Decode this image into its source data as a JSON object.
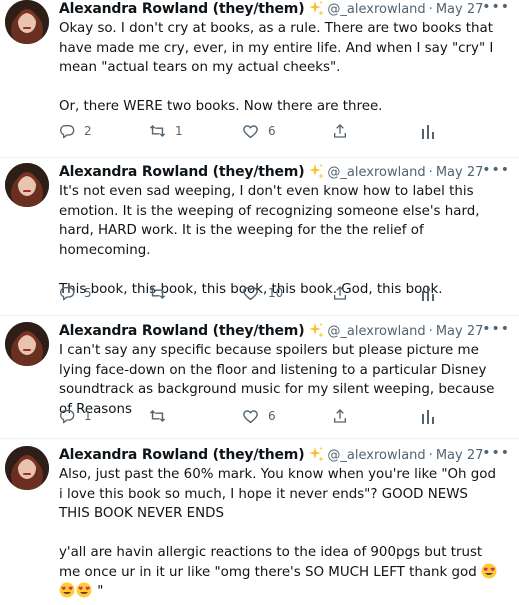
{
  "tweets": [
    {
      "author": "Alexandra Rowland (they/them)",
      "handle": "@_alexrowland",
      "separator": "·",
      "date": "May 27",
      "paragraphs": [
        "Okay so. I don't cry at books, as a rule. There are two books that have made me cry, ever, in my entire life. And when I say \"cry\" I mean \"actual tears on my actual cheeks\".",
        "Or, there WERE two books. Now there are three."
      ],
      "replies": "2",
      "retweets": "1",
      "likes": "6"
    },
    {
      "author": "Alexandra Rowland (they/them)",
      "handle": "@_alexrowland",
      "separator": "·",
      "date": "May 27",
      "paragraphs": [
        "It's not even sad weeping, I don't even know how to label this emotion. It is the weeping of recognizing someone else's hard, hard, HARD work. It is the weeping for the the relief of homecoming.",
        "This book, this book, this book, this book. God, this book."
      ],
      "replies": "5",
      "retweets": "",
      "likes": "10"
    },
    {
      "author": "Alexandra Rowland (they/them)",
      "handle": "@_alexrowland",
      "separator": "·",
      "date": "May 27",
      "paragraphs": [
        "I can't say any specific because spoilers but please picture me lying face-down on the floor and listening to a particular Disney soundtrack as background music for my silent weeping, because of Reasons"
      ],
      "replies": "1",
      "retweets": "",
      "likes": "6"
    },
    {
      "author": "Alexandra Rowland (they/them)",
      "handle": "@_alexrowland",
      "separator": "·",
      "date": "May 27",
      "paragraphs": [
        "Also, just past the 60% mark. You know when you're like \"Oh god i love this book so much, I hope it never ends\"? GOOD NEWS THIS BOOK NEVER ENDS"
      ],
      "last_paragraph_text": "y'all are havin allergic reactions to the idea of 900pgs but trust me once ur in it ur like \"omg there's SO MUCH LEFT thank god",
      "last_paragraph_end": "\""
    }
  ],
  "icons": {
    "sparkle": "sparkles-icon",
    "more": "more-icon",
    "reply": "reply-icon",
    "retweet": "retweet-icon",
    "like": "heart-icon",
    "share": "share-icon",
    "analytics": "analytics-icon",
    "emoji": "heart-eyes-emoji"
  },
  "more_label": "•••",
  "colors": {
    "text": "#0f1419",
    "muted": "#536471",
    "divider": "#eff3f4",
    "sparkle": "#f4c430"
  }
}
